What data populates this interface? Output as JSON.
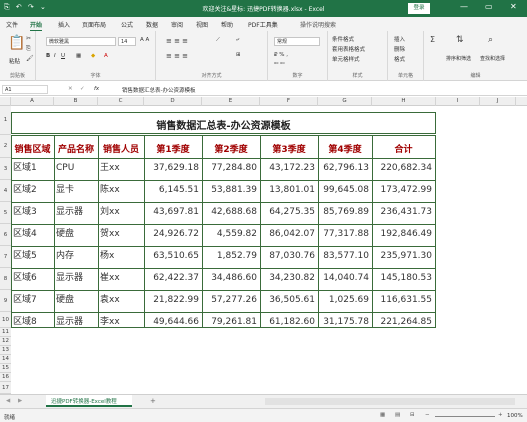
{
  "titlebar": {
    "quick_access": "⎘ ↶ ↷ ⌄",
    "title": "欢迎关注&星标: 迅捷PDF转换器.xlsx - Excel",
    "login_label": "登录",
    "min": "—",
    "restore": "▭",
    "close": "✕"
  },
  "tabs": [
    "文件",
    "开始",
    "插入",
    "页面布局",
    "公式",
    "数据",
    "审阅",
    "视图",
    "帮助",
    "PDF工具集",
    "操作说明搜索"
  ],
  "ribbon": {
    "paste": "粘贴",
    "clipboard_group": "剪贴板",
    "font_name": "微软雅黑",
    "font_size": "14",
    "font_group": "字体",
    "align_group": "对齐方式",
    "number_format": "常规",
    "number_group": "数字",
    "cond_format": "条件格式",
    "table_format": "套用表格格式",
    "cell_style": "单元格样式",
    "style_group": "样式",
    "insert": "插入",
    "delete": "删除",
    "format": "格式",
    "cells_group": "单元格",
    "sort_filter": "排序和筛选",
    "find_select": "查找和选择",
    "edit_group": "编辑"
  },
  "formula_bar": {
    "name_box": "A1",
    "fx": "fx",
    "content": "销售数据汇总表-办公资源模板"
  },
  "columns": [
    "A",
    "B",
    "C",
    "D",
    "E",
    "F",
    "G",
    "H",
    "I",
    "J"
  ],
  "rows": [
    "1",
    "2",
    "3",
    "4",
    "5",
    "6",
    "7",
    "8",
    "9",
    "10",
    "11",
    "12",
    "13",
    "14",
    "15",
    "16",
    "17"
  ],
  "table": {
    "title": "销售数据汇总表-办公资源模板",
    "headers": [
      "销售区域",
      "产品名称",
      "销售人员",
      "第1季度",
      "第2季度",
      "第3季度",
      "第4季度",
      "合计"
    ],
    "data": [
      [
        "区域1",
        "CPU",
        "王xx",
        "37,629.18",
        "77,284.80",
        "43,172.23",
        "62,796.13",
        "220,682.34"
      ],
      [
        "区域2",
        "显卡",
        "陈xx",
        "6,145.51",
        "53,881.39",
        "13,801.01",
        "99,645.08",
        "173,472.99"
      ],
      [
        "区域3",
        "显示器",
        "刘xx",
        "43,697.81",
        "42,688.68",
        "64,275.35",
        "85,769.89",
        "236,431.73"
      ],
      [
        "区域4",
        "硬盘",
        "贺xx",
        "24,926.72",
        "4,559.82",
        "86,042.07",
        "77,317.88",
        "192,846.49"
      ],
      [
        "区域5",
        "内存",
        "杨x",
        "63,510.65",
        "1,852.79",
        "87,030.76",
        "83,577.10",
        "235,971.30"
      ],
      [
        "区域6",
        "显示器",
        "崔xx",
        "62,422.37",
        "34,486.60",
        "34,230.82",
        "14,040.74",
        "145,180.53"
      ],
      [
        "区域7",
        "硬盘",
        "袁xx",
        "21,822.99",
        "57,277.26",
        "36,505.61",
        "1,025.69",
        "116,631.55"
      ],
      [
        "区域8",
        "显示器",
        "李xx",
        "49,644.66",
        "79,261.81",
        "61,182.60",
        "31,175.78",
        "221,264.85"
      ]
    ]
  },
  "sheet_tabs": {
    "active": "迅捷PDF转换器-Excel教程",
    "add": "+"
  },
  "status": {
    "ready": "就绪",
    "zoom": "100%"
  },
  "colors": {
    "accent": "#217346",
    "header_text": "#a00000",
    "border": "#3a6b3a"
  }
}
